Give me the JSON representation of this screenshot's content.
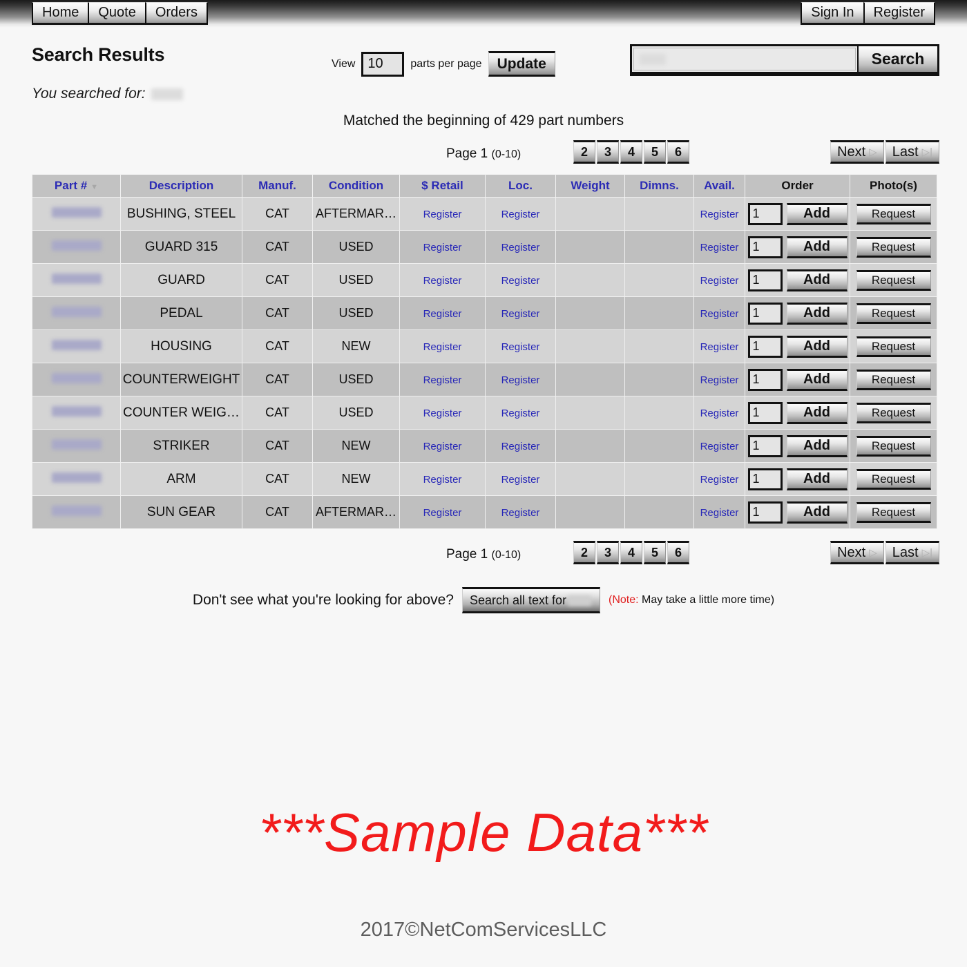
{
  "nav": {
    "left_items": [
      {
        "label": "Home"
      },
      {
        "label": "Quote"
      },
      {
        "label": "Orders"
      }
    ],
    "right_items": [
      {
        "label": "Sign In"
      },
      {
        "label": "Register"
      }
    ]
  },
  "header": {
    "page_title": "Search Results",
    "searched_for_label": "You searched for:",
    "searched_for_value": "",
    "view_label": "View",
    "per_page_value": "10",
    "per_page_suffix": "parts per page",
    "update_label": "Update",
    "search_value": "",
    "search_placeholder": "",
    "search_button_label": "Search",
    "matched_text": "Matched the beginning of 429 part numbers"
  },
  "pagination": {
    "page_label": "Page",
    "current_page": "1",
    "range_text": "(0-10)",
    "page_numbers": [
      "2",
      "3",
      "4",
      "5",
      "6"
    ],
    "next_label": "Next",
    "last_label": "Last",
    "next_arrow": "▷",
    "last_arrow": "▷|"
  },
  "table": {
    "columns": [
      {
        "label": "Part #",
        "sort": "▼",
        "accent": "blue"
      },
      {
        "label": "Description",
        "accent": "blue"
      },
      {
        "label": "Manuf.",
        "accent": "blue"
      },
      {
        "label": "Condition",
        "accent": "blue"
      },
      {
        "label": "$ Retail",
        "accent": "blue"
      },
      {
        "label": "Loc.",
        "accent": "blue"
      },
      {
        "label": "Weight",
        "accent": "blue"
      },
      {
        "label": "Dimns.",
        "accent": "blue"
      },
      {
        "label": "Avail.",
        "accent": "blue"
      },
      {
        "label": "Order",
        "accent": "black"
      },
      {
        "label": "Photo(s)",
        "accent": "black"
      }
    ],
    "register_link_label": "Register",
    "qty_default": "1",
    "add_label": "Add",
    "request_label": "Request",
    "rows": [
      {
        "part": "",
        "description": "BUSHING, STEEL",
        "manuf": "CAT",
        "condition": "AFTERMAR…",
        "retail": "Register",
        "loc": "Register",
        "weight": "",
        "dimns": "",
        "avail": "Register",
        "qty": "1"
      },
      {
        "part": "",
        "description": "GUARD 315",
        "manuf": "CAT",
        "condition": "USED",
        "retail": "Register",
        "loc": "Register",
        "weight": "",
        "dimns": "",
        "avail": "Register",
        "qty": "1"
      },
      {
        "part": "",
        "description": "GUARD",
        "manuf": "CAT",
        "condition": "USED",
        "retail": "Register",
        "loc": "Register",
        "weight": "",
        "dimns": "",
        "avail": "Register",
        "qty": "1"
      },
      {
        "part": "",
        "description": "PEDAL",
        "manuf": "CAT",
        "condition": "USED",
        "retail": "Register",
        "loc": "Register",
        "weight": "",
        "dimns": "",
        "avail": "Register",
        "qty": "1"
      },
      {
        "part": "",
        "description": "HOUSING",
        "manuf": "CAT",
        "condition": "NEW",
        "retail": "Register",
        "loc": "Register",
        "weight": "",
        "dimns": "",
        "avail": "Register",
        "qty": "1"
      },
      {
        "part": "",
        "description": "COUNTERWEIGHT",
        "manuf": "CAT",
        "condition": "USED",
        "retail": "Register",
        "loc": "Register",
        "weight": "",
        "dimns": "",
        "avail": "Register",
        "qty": "1"
      },
      {
        "part": "",
        "description": "COUNTER WEIG…",
        "manuf": "CAT",
        "condition": "USED",
        "retail": "Register",
        "loc": "Register",
        "weight": "",
        "dimns": "",
        "avail": "Register",
        "qty": "1"
      },
      {
        "part": "",
        "description": "STRIKER",
        "manuf": "CAT",
        "condition": "NEW",
        "retail": "Register",
        "loc": "Register",
        "weight": "",
        "dimns": "",
        "avail": "Register",
        "qty": "1"
      },
      {
        "part": "",
        "description": "ARM",
        "manuf": "CAT",
        "condition": "NEW",
        "retail": "Register",
        "loc": "Register",
        "weight": "",
        "dimns": "",
        "avail": "Register",
        "qty": "1"
      },
      {
        "part": "",
        "description": "SUN GEAR",
        "manuf": "CAT",
        "condition": "AFTERMAR…",
        "retail": "Register",
        "loc": "Register",
        "weight": "",
        "dimns": "",
        "avail": "Register",
        "qty": "1"
      }
    ]
  },
  "search_all": {
    "question": "Don't see what you're looking for above?",
    "button_label": "Search all text for",
    "button_value": "",
    "note_prefix": "(Note:",
    "note_text": " May take a little more time)"
  },
  "footer": {
    "sample_text": "***Sample Data***",
    "copyright": "2017©NetComServicesLLC"
  },
  "colors": {
    "accent_blue": "#2b2bb5",
    "link_blue": "#2727b8",
    "sample_red": "#f21b1b",
    "note_red": "#e02020",
    "row_odd": "#d4d4d4",
    "row_even": "#bfbfbf",
    "header_gray": "#c2c2c2",
    "page_bg": "#f7f7f7"
  }
}
